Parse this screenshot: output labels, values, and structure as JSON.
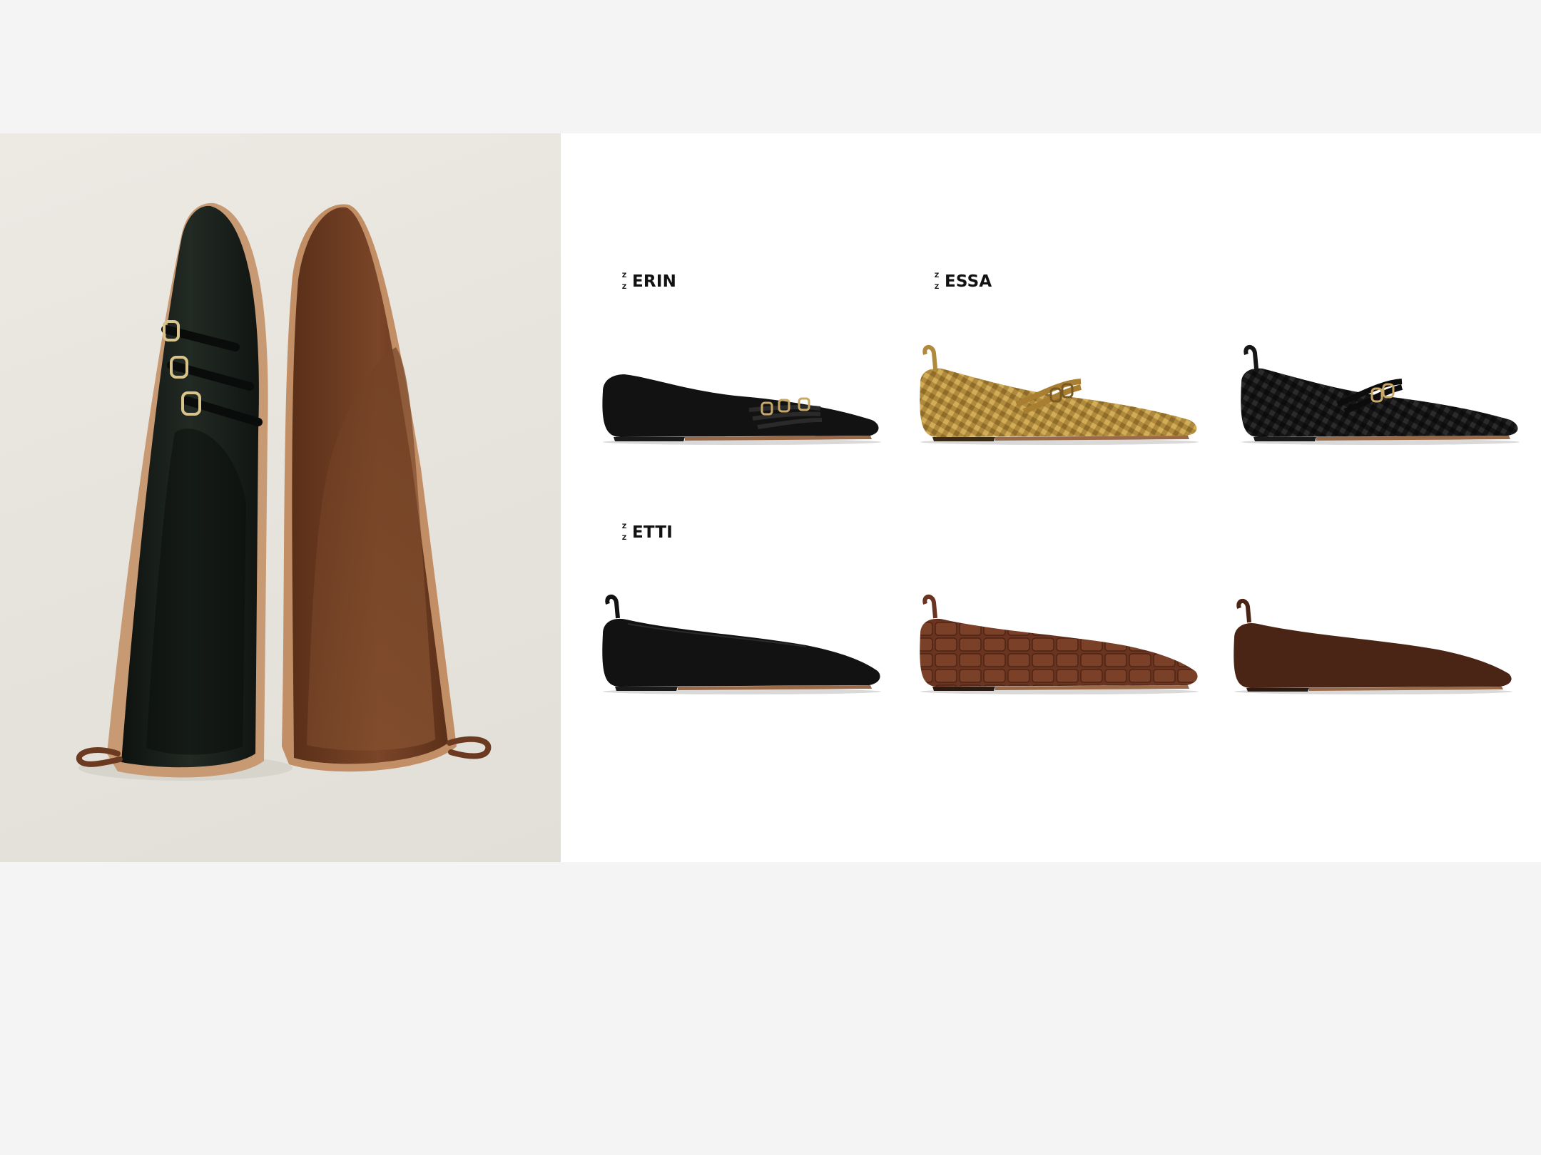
{
  "labels": {
    "erin": "ERIN",
    "essa": "ESSA",
    "etti": "ETTI"
  },
  "brand_mark": [
    "Z",
    "Z"
  ],
  "products": [
    {
      "style": "ERIN",
      "color": "#141414",
      "finish": "smooth leather",
      "straps": "triple buckle"
    },
    {
      "style": "ESSA",
      "color": "#b08a3c",
      "finish": "woven metallic",
      "straps": "double buckle"
    },
    {
      "style": "ESSA",
      "color": "#161616",
      "finish": "woven leather",
      "straps": "double buckle"
    },
    {
      "style": "ETTI",
      "color": "#121212",
      "finish": "smooth leather",
      "straps": "none"
    },
    {
      "style": "ETTI",
      "color": "#6a3420",
      "finish": "croc embossed",
      "straps": "none"
    },
    {
      "style": "ETTI",
      "color": "#4a2414",
      "finish": "suede",
      "straps": "none"
    }
  ],
  "hero": {
    "left_shoe_color": "#1b211c",
    "right_shoe_color": "#6e3d22",
    "background": "#e8e6df"
  }
}
